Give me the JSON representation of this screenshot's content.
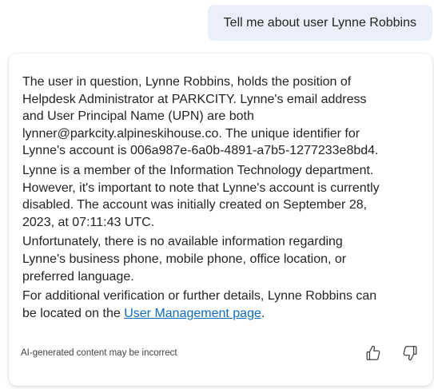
{
  "user_message": {
    "text": "Tell me about user Lynne Robbins"
  },
  "response": {
    "paragraphs": [
      "The user in question, Lynne Robbins, holds the position of Helpdesk Administrator at PARKCITY. Lynne's email address and User Principal Name (UPN) are both lynner@parkcity.alpineskihouse.co. The unique identifier for Lynne's account is 006a987e-6a0b-4891-a7b5-1277233e8bd4.",
      "Lynne is a member of the Information Technology department. However, it's important to note that Lynne's account is currently disabled. The account was initially created on September 28, 2023, at 07:11:43 UTC.",
      "Unfortunately, there is no available information regarding Lynne's business phone, mobile phone, office location, or preferred language."
    ],
    "last_paragraph_prefix": "For additional verification or further details, Lynne Robbins can be located on the ",
    "link_text": "User Management page",
    "last_paragraph_suffix": "."
  },
  "footer": {
    "disclaimer": "AI-generated content may be incorrect",
    "thumbs_up_icon": "thumbs-up-icon",
    "thumbs_down_icon": "thumbs-down-icon"
  }
}
